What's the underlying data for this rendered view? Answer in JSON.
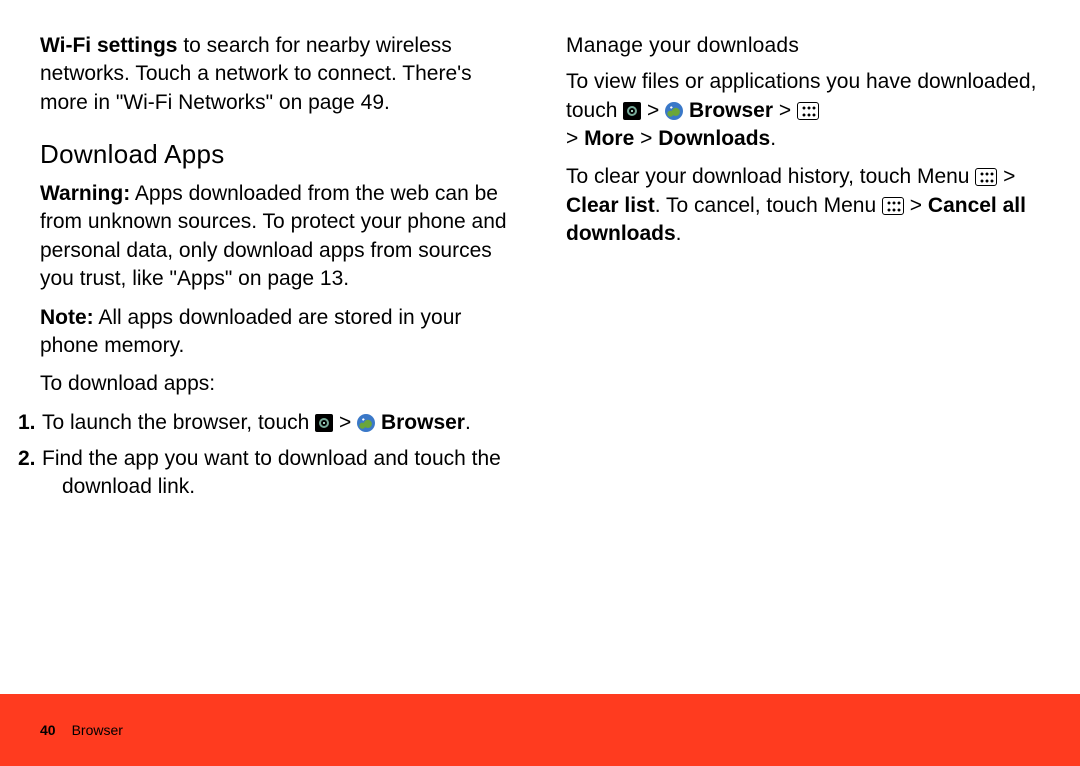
{
  "left": {
    "wifi_bold": "Wi-Fi settings",
    "wifi_rest": " to search for nearby wireless networks. Touch a network to connect. There's more in \"Wi-Fi Networks\" on page 49.",
    "heading": "Download Apps",
    "warn_bold": "Warning:",
    "warn_body": " Apps downloaded from the web can be from unknown sources. To protect your phone and personal data, only download apps from sources you trust, like \"Apps\" on page 13.",
    "note_bold": "Note:",
    "note_body": " All apps downloaded are stored in your phone memory.",
    "to_download": "To download apps:",
    "step1_num": "1.",
    "step1_text_pre": "To launch the browser, touch ",
    "step1_gt": " > ",
    "step1_browser": " Browser",
    "step1_end": ".",
    "step2_num": "2.",
    "step2_text": "Find the app you want to download and touch the download link."
  },
  "right": {
    "heading": "Manage your downloads",
    "p1_a": "To view files or applications you have downloaded, touch ",
    "gt1": " > ",
    "browser_bold": " Browser",
    "gt2": " > ",
    "break": " ",
    "gt3": "> ",
    "more_bold": "More",
    "gt4": " > ",
    "downloads_bold": "Downloads",
    "p1_end": ".",
    "p2_a": "To clear your download history, touch Menu ",
    "gt5": " > ",
    "clearlist_bold": "Clear list",
    "p2_b": ". To cancel, touch Menu ",
    "gt6": " > ",
    "cancel_bold": "Cancel all downloads",
    "p2_end": "."
  },
  "footer": {
    "page": "40",
    "section": "Browser"
  }
}
